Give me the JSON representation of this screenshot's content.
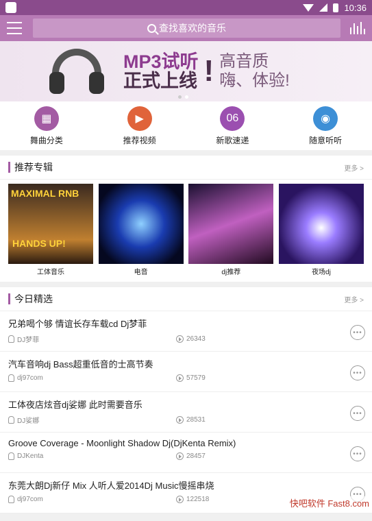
{
  "status": {
    "time": "10:36"
  },
  "search": {
    "placeholder": "查找喜欢的音乐"
  },
  "banner": {
    "line1": "MP3试听",
    "line2": "正式上线",
    "sub1": "高音质",
    "sub2": "嗨、体验!"
  },
  "categories": [
    {
      "label": "舞曲分类",
      "color": "#a35ba3",
      "icon": "grid-icon"
    },
    {
      "label": "推荐视频",
      "color": "#e0633a",
      "icon": "video-icon"
    },
    {
      "label": "新歌速递",
      "color": "#9b4fb0",
      "icon": "new-songs-icon",
      "badge": "06"
    },
    {
      "label": "随意听听",
      "color": "#3d8fd6",
      "icon": "radio-icon"
    }
  ],
  "albums_section": {
    "title": "推荐专辑",
    "more": "更多 >"
  },
  "albums": [
    {
      "caption": "工体音乐",
      "cover_text1": "MAXIMAL RNB",
      "cover_text2": "HANDS UP!"
    },
    {
      "caption": "电音"
    },
    {
      "caption": "dj推荐"
    },
    {
      "caption": "夜场dj"
    }
  ],
  "today_section": {
    "title": "今日精选",
    "more": "更多 >"
  },
  "songs": [
    {
      "title": "兄弟喝个够 情谊长存车载cd Dj梦菲",
      "artist": "DJ梦菲",
      "plays": "26343"
    },
    {
      "title": "汽车音响dj Bass超重低音的士高节奏",
      "artist": "dj97com",
      "plays": "57579"
    },
    {
      "title": "工体夜店炫音dj娑娜 此时需要音乐",
      "artist": "DJ娑娜",
      "plays": "28531"
    },
    {
      "title": "Groove Coverage - Moonlight Shadow Dj(DjKenta Remix)",
      "artist": "DJKenta",
      "plays": "28457"
    },
    {
      "title": "东莞大朗Dj新仔 Mix 人听人爱2014Dj Music慢摇串烧",
      "artist": "dj97com",
      "plays": "122518"
    }
  ],
  "watermark": "快吧软件 Fast8.com"
}
